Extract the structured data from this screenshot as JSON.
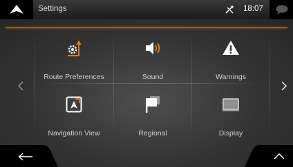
{
  "app": {
    "title": "Settings",
    "time": "18:07"
  },
  "icons": {
    "logo": "navigation-arrow-icon",
    "gps": "no-gps-signal-icon",
    "messages": "speech-bubble-icon",
    "prev": "chevron-left-icon",
    "next": "chevron-right-icon",
    "back": "back-arrow-icon",
    "up": "chevron-up-icon"
  },
  "colors": {
    "accent": "#e47b1c",
    "tile_text": "#cfcfcf"
  },
  "tiles": [
    {
      "label": "Route Preferences",
      "icon": "route-preferences-icon"
    },
    {
      "label": "Sound",
      "icon": "speaker-icon"
    },
    {
      "label": "Warnings",
      "icon": "warning-triangle-icon"
    },
    {
      "label": "Navigation View",
      "icon": "navigation-view-icon"
    },
    {
      "label": "Regional",
      "icon": "regional-flag-icon"
    },
    {
      "label": "Display",
      "icon": "display-icon"
    }
  ]
}
